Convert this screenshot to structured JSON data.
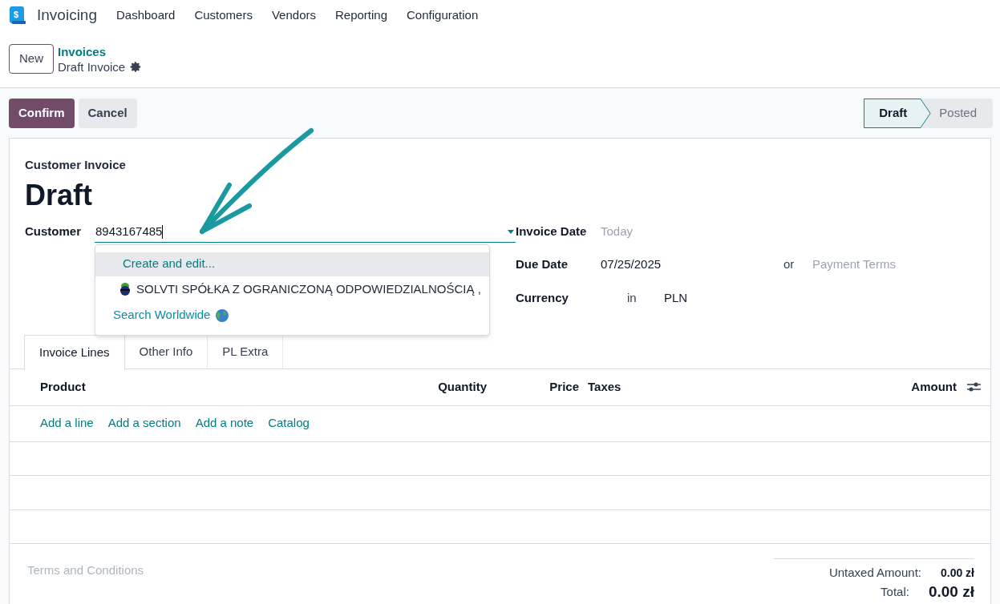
{
  "navbar": {
    "logo_glyph": "$",
    "app_name": "Invoicing",
    "menu": [
      "Dashboard",
      "Customers",
      "Vendors",
      "Reporting",
      "Configuration"
    ]
  },
  "control_panel": {
    "new_button": "New",
    "breadcrumb": "Invoices",
    "record": "Draft Invoice"
  },
  "actions": [
    "Confirm",
    "Cancel"
  ],
  "statusbar": [
    {
      "label": "Draft",
      "selected": true
    },
    {
      "label": "Posted",
      "selected": false
    }
  ],
  "form": {
    "subtitle": "Customer Invoice",
    "title": "Draft",
    "customer": {
      "label": "Customer",
      "value": "8943167485"
    },
    "dropdown": [
      {
        "kind": "create",
        "label": "Create and edit...",
        "selected": true
      },
      {
        "kind": "partner",
        "label": "SOLVTI SPÓŁKA Z OGRANICZONĄ ODPOWIEDZIALNOŚCIĄ ,",
        "selected": false
      },
      {
        "kind": "search",
        "label": "Search Worldwide",
        "selected": false
      }
    ],
    "invoice_date": {
      "label": "Invoice Date",
      "placeholder": "Today"
    },
    "due_date": {
      "label": "Due Date",
      "value": "07/25/2025",
      "or": "or",
      "placeholder": "Payment Terms"
    },
    "currency": {
      "label": "Currency",
      "in": "in",
      "value": "PLN"
    },
    "tabs": [
      {
        "label": "Invoice Lines",
        "selected": true
      },
      {
        "label": "Other Info",
        "selected": false
      },
      {
        "label": "PL Extra",
        "selected": false
      }
    ],
    "columns": [
      {
        "label": "Product",
        "kind": "text"
      },
      {
        "label": "Quantity",
        "kind": "number"
      },
      {
        "label": "Price",
        "kind": "number"
      },
      {
        "label": "Taxes",
        "kind": "text"
      },
      {
        "label": "Amount",
        "kind": "number"
      }
    ],
    "line_actions": [
      "Add a line",
      "Add a section",
      "Add a note",
      "Catalog"
    ],
    "terms": {
      "placeholder": "Terms and Conditions"
    },
    "totals": [
      {
        "label": "Untaxed Amount:",
        "value": "0.00 zł",
        "kind": "subtotal"
      },
      {
        "label": "Total:",
        "value": "0.00 zł",
        "kind": "total"
      }
    ]
  }
}
